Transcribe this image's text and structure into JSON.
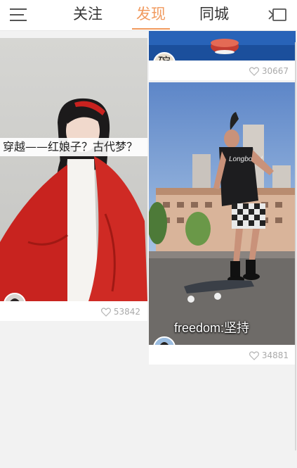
{
  "nav": {
    "tabs": [
      "关注",
      "发现",
      "同城"
    ],
    "active_tab": "发现",
    "accent_color": "#f19a5e",
    "left_icon": "menu-icon",
    "right_icon": "message-icon"
  },
  "feed": {
    "left": [
      {
        "caption": "穿越——红娘子？古代梦？",
        "likes": "53842",
        "avatar_icon": "user-avatar"
      }
    ],
    "right": [
      {
        "avatar_text": "碗",
        "likes": "30667"
      },
      {
        "caption": "freedom:坚持",
        "shirt_text": "Longboard",
        "likes": "34881",
        "avatar_icon": "user-avatar"
      }
    ]
  }
}
